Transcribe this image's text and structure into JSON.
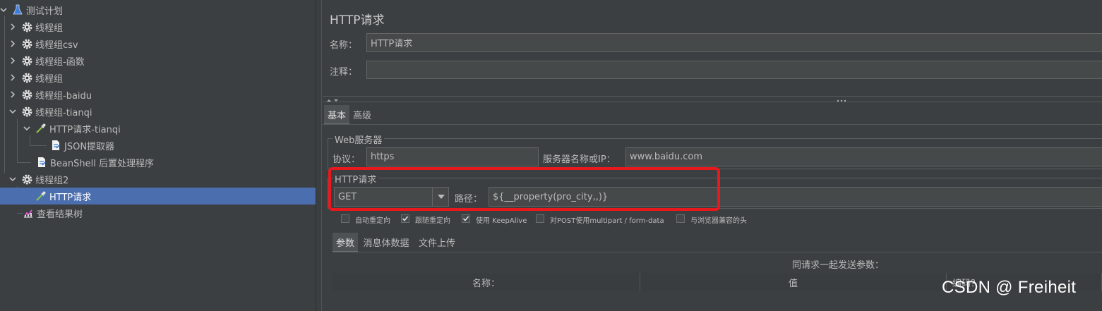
{
  "tree": {
    "root": {
      "label": "测试计划",
      "icon": "flask-icon"
    },
    "nodes": [
      {
        "label": "线程组",
        "icon": "gear-icon",
        "chevron": "right"
      },
      {
        "label": "线程组csv",
        "icon": "gear-icon",
        "chevron": "right"
      },
      {
        "label": "线程组-函数",
        "icon": "gear-icon",
        "chevron": "right"
      },
      {
        "label": "线程组",
        "icon": "gear-icon",
        "chevron": "right"
      },
      {
        "label": "线程组-baidu",
        "icon": "gear-icon",
        "chevron": "right"
      },
      {
        "label": "线程组-tianqi",
        "icon": "gear-icon",
        "chevron": "down"
      },
      {
        "label": "HTTP请求-tianqi",
        "icon": "pipette-icon",
        "chevron": "down"
      },
      {
        "label": "JSON提取器",
        "icon": "extractor-icon"
      },
      {
        "label": "BeanShell 后置处理程序",
        "icon": "extractor-icon"
      },
      {
        "label": "线程组2",
        "icon": "gear-icon",
        "chevron": "down"
      },
      {
        "label": "HTTP请求",
        "icon": "pipette-icon",
        "selected": true
      },
      {
        "label": "查看结果树",
        "icon": "chart-icon"
      }
    ]
  },
  "panel": {
    "title": "HTTP请求",
    "name_label": "名称：",
    "name_value": "HTTP请求",
    "comment_label": "注释：",
    "comment_value": "",
    "tabs": [
      "基本",
      "高级"
    ],
    "web_server": {
      "legend": "Web服务器",
      "protocol_label": "协议：",
      "protocol_value": "https",
      "server_label": "服务器名称或IP：",
      "server_value": "www.baidu.com"
    },
    "http_request": {
      "legend": "HTTP请求",
      "method": "GET",
      "path_label": "路径：",
      "path_value": "${__property(pro_city,,)}"
    },
    "checkboxes": [
      {
        "label": "自动重定向",
        "checked": false
      },
      {
        "label": "跟随重定向",
        "checked": true
      },
      {
        "label": "使用 KeepAlive",
        "checked": true
      },
      {
        "label": "对POST使用multipart / form-data",
        "checked": false
      },
      {
        "label": "与浏览器兼容的头",
        "checked": false
      }
    ],
    "sub_tabs": [
      "参数",
      "消息体数据",
      "文件上传"
    ],
    "params_caption": "同请求一起发送参数：",
    "table_headers": [
      "名称：",
      "值",
      "编码？"
    ]
  },
  "watermark": "CSDN @ Freiheit",
  "colors": {
    "selection": "#4b6eaf",
    "highlight": "#e8191c",
    "background": "#3c3f41"
  }
}
